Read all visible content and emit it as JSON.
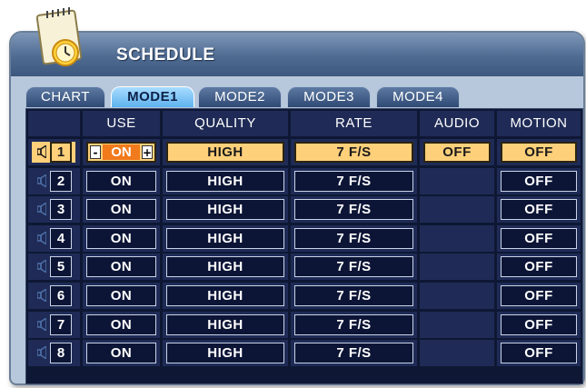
{
  "window": {
    "title": "SCHEDULE"
  },
  "icons": {
    "titlebar": "clock-notepad-icon",
    "channel": "speaker-icon"
  },
  "colors": {
    "accent": "#5eb2ee",
    "selected_row": "#ffd07a",
    "use_value": "#f07a1c",
    "background": "#0e1733"
  },
  "tabs": [
    {
      "label": "CHART",
      "active": false
    },
    {
      "label": "MODE1",
      "active": true
    },
    {
      "label": "MODE2",
      "active": false
    },
    {
      "label": "MODE3",
      "active": false
    },
    {
      "label": "MODE4",
      "active": false
    }
  ],
  "headers": {
    "use": "USE",
    "quality": "QUALITY",
    "rate": "RATE",
    "audio": "AUDIO",
    "motion": "MOTION"
  },
  "use_stepper": {
    "minus": "-",
    "plus": "+"
  },
  "rows": [
    {
      "ch": "1",
      "use": "ON",
      "quality": "HIGH",
      "rate": "7 F/S",
      "audio": "OFF",
      "motion": "OFF",
      "selected": true
    },
    {
      "ch": "2",
      "use": "ON",
      "quality": "HIGH",
      "rate": "7 F/S",
      "audio": "",
      "motion": "OFF"
    },
    {
      "ch": "3",
      "use": "ON",
      "quality": "HIGH",
      "rate": "7 F/S",
      "audio": "",
      "motion": "OFF"
    },
    {
      "ch": "4",
      "use": "ON",
      "quality": "HIGH",
      "rate": "7 F/S",
      "audio": "",
      "motion": "OFF"
    },
    {
      "ch": "5",
      "use": "ON",
      "quality": "HIGH",
      "rate": "7 F/S",
      "audio": "",
      "motion": "OFF"
    },
    {
      "ch": "6",
      "use": "ON",
      "quality": "HIGH",
      "rate": "7 F/S",
      "audio": "",
      "motion": "OFF"
    },
    {
      "ch": "7",
      "use": "ON",
      "quality": "HIGH",
      "rate": "7 F/S",
      "audio": "",
      "motion": "OFF"
    },
    {
      "ch": "8",
      "use": "ON",
      "quality": "HIGH",
      "rate": "7 F/S",
      "audio": "",
      "motion": "OFF"
    }
  ]
}
